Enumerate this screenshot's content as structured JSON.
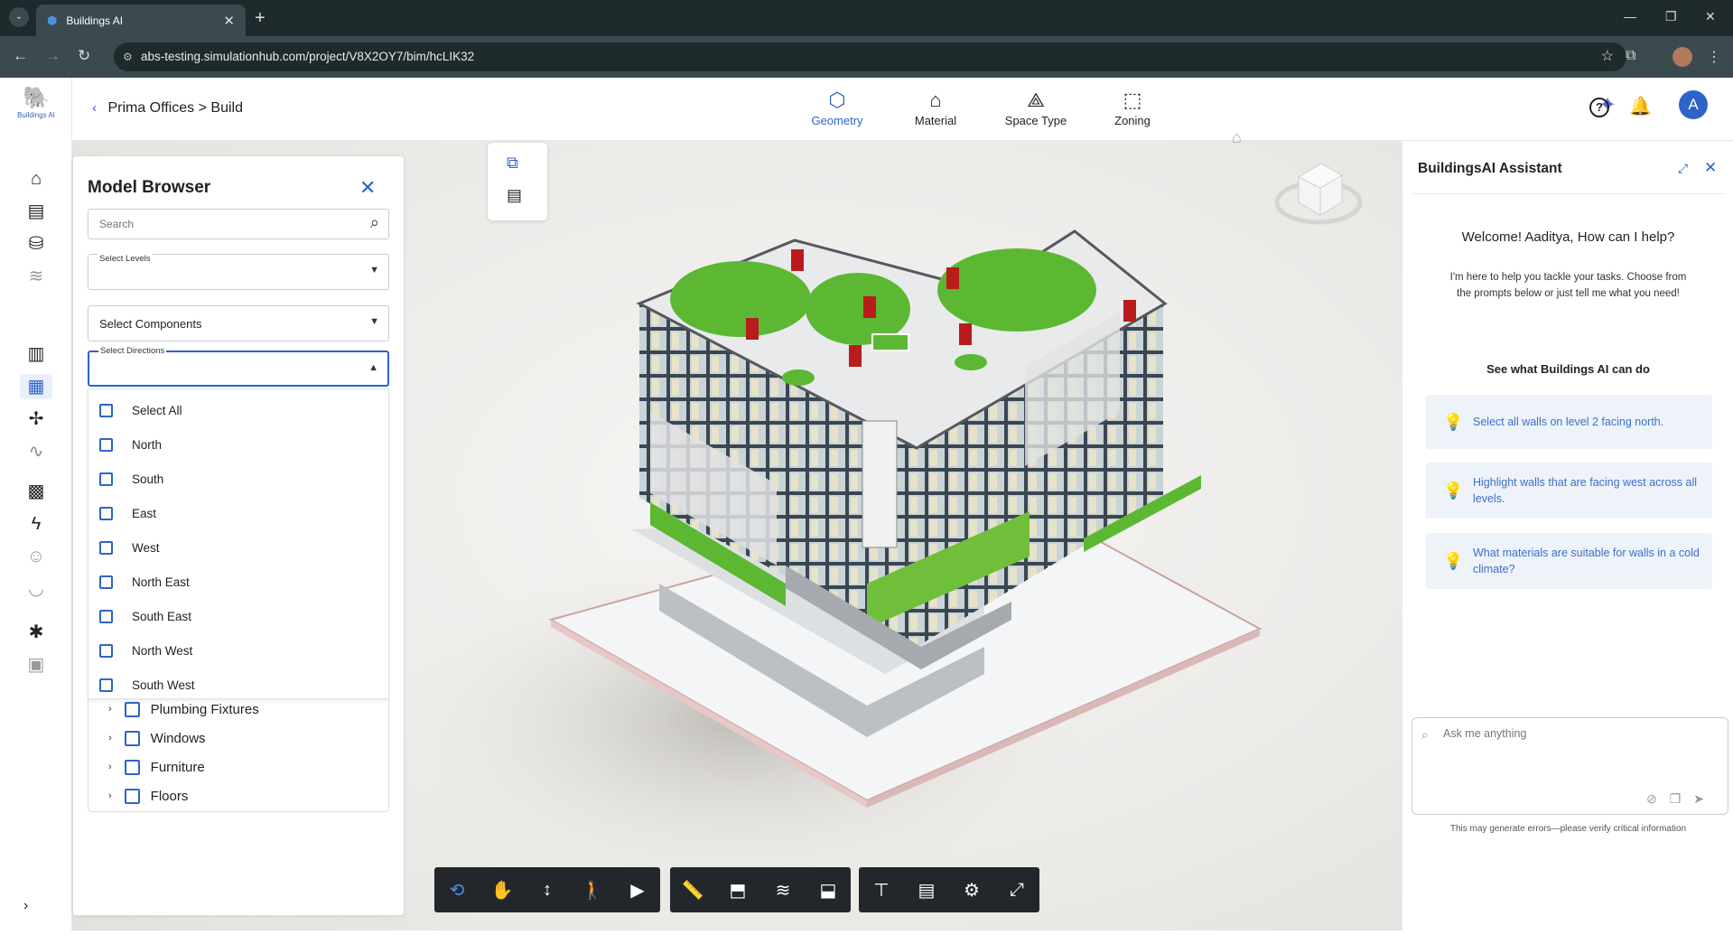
{
  "browser": {
    "tab_title": "Buildings AI",
    "url": "abs-testing.simulationhub.com/project/V8X2OY7/bim/hcLIK32"
  },
  "app": {
    "logo_text": "Buildings AI",
    "breadcrumb": "Prima Offices > Build",
    "top_tabs": [
      "Geometry",
      "Material",
      "Space Type",
      "Zoning"
    ],
    "user_initial": "A"
  },
  "model_browser": {
    "title": "Model Browser",
    "search_placeholder": "Search",
    "select_levels_label": "Select Levels",
    "select_components": "Select Components",
    "select_directions_label": "Select Directions",
    "direction_options": [
      "Select All",
      "North",
      "South",
      "East",
      "West",
      "North East",
      "South East",
      "North West",
      "South West"
    ],
    "tree_items": [
      "Plumbing Fixtures",
      "Windows",
      "Furniture",
      "Floors"
    ]
  },
  "assistant": {
    "title": "BuildingsAI Assistant",
    "welcome": "Welcome! Aaditya, How can I help?",
    "intro": "I'm here to help you tackle your tasks. Choose from the prompts below or just tell me what you need!",
    "see_what": "See what Buildings AI can do",
    "prompts": [
      "Select all walls on level 2 facing north.",
      "Highlight walls that are facing west across all levels.",
      "What materials are suitable for walls in a cold climate?"
    ],
    "input_placeholder": "Ask me anything",
    "disclaimer": "This may generate errors—please verify critical information"
  },
  "colors": {
    "accent": "#2d64c8",
    "roof_green": "#5cb833",
    "hvac_red": "#b81c1c"
  }
}
